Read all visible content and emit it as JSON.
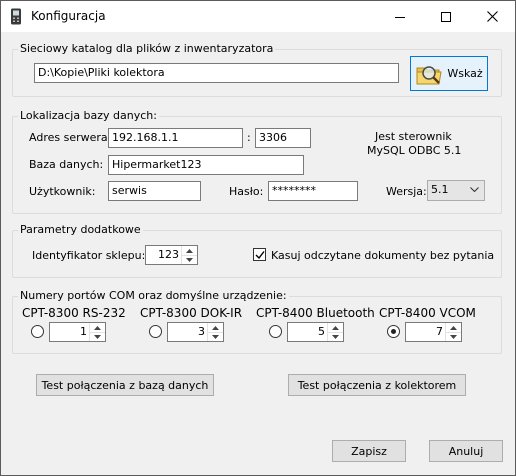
{
  "window": {
    "title": "Konfiguracja"
  },
  "folder_group": {
    "legend": "Sieciowy katalog dla plików z inwentaryzatora",
    "path": "D:\\Kopie\\Pliki kolektora",
    "browse_label": "Wskaż"
  },
  "db_group": {
    "legend": "Lokalizacja bazy danych:",
    "server_label": "Adres serwera:",
    "server_value": "192.168.1.1",
    "colon": ":",
    "port_value": "3306",
    "db_label": "Baza danych:",
    "db_value": "Hipermarket123",
    "user_label": "Użytkownik:",
    "user_value": "serwis",
    "password_label": "Hasło:",
    "password_value": "********",
    "version_label": "Wersja:",
    "version_value": "5.1",
    "driver_line1": "Jest sterownik",
    "driver_line2": "MySQL ODBC 5.1"
  },
  "extra_group": {
    "legend": "Parametry dodatkowe",
    "shop_label": "Identyfikator sklepu:",
    "shop_value": "123",
    "delete_label": "Kasuj odczytane dokumenty bez pytania",
    "delete_checked": true
  },
  "com_group": {
    "legend": "Numery portów COM oraz domyślne urządzenie:",
    "devices": [
      {
        "name": "CPT-8300 RS-232",
        "port": "1",
        "selected": false
      },
      {
        "name": "CPT-8300 DOK-IR",
        "port": "3",
        "selected": false
      },
      {
        "name": "CPT-8400 Bluetooth",
        "port": "5",
        "selected": false
      },
      {
        "name": "CPT-8400 VCOM",
        "port": "7",
        "selected": true
      }
    ]
  },
  "buttons": {
    "test_db": "Test połączenia z bazą danych",
    "test_collector": "Test połączenia z kolektorem",
    "save": "Zapisz",
    "cancel": "Anuluj"
  }
}
